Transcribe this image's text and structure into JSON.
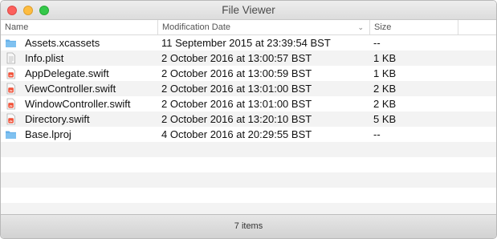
{
  "window": {
    "title": "File Viewer"
  },
  "columns": {
    "name": "Name",
    "date": "Modification Date",
    "size": "Size"
  },
  "files": [
    {
      "name": "Assets.xcassets",
      "date": "11 September 2015 at 23:39:54 BST",
      "size": "--",
      "icon": "folder-icon"
    },
    {
      "name": "Info.plist",
      "date": "2 October 2016 at 13:00:57 BST",
      "size": "1 KB",
      "icon": "plist-file-icon"
    },
    {
      "name": "AppDelegate.swift",
      "date": "2 October 2016 at 13:00:59 BST",
      "size": "1 KB",
      "icon": "swift-file-icon"
    },
    {
      "name": "ViewController.swift",
      "date": "2 October 2016 at 13:01:00 BST",
      "size": "2 KB",
      "icon": "swift-file-icon"
    },
    {
      "name": "WindowController.swift",
      "date": "2 October 2016 at 13:01:00 BST",
      "size": "2 KB",
      "icon": "swift-file-icon"
    },
    {
      "name": "Directory.swift",
      "date": "2 October 2016 at 13:20:10 BST",
      "size": "5 KB",
      "icon": "swift-file-icon"
    },
    {
      "name": "Base.lproj",
      "date": "4 October 2016 at 20:29:55 BST",
      "size": "--",
      "icon": "folder-icon"
    }
  ],
  "status": {
    "text": "7 items"
  }
}
